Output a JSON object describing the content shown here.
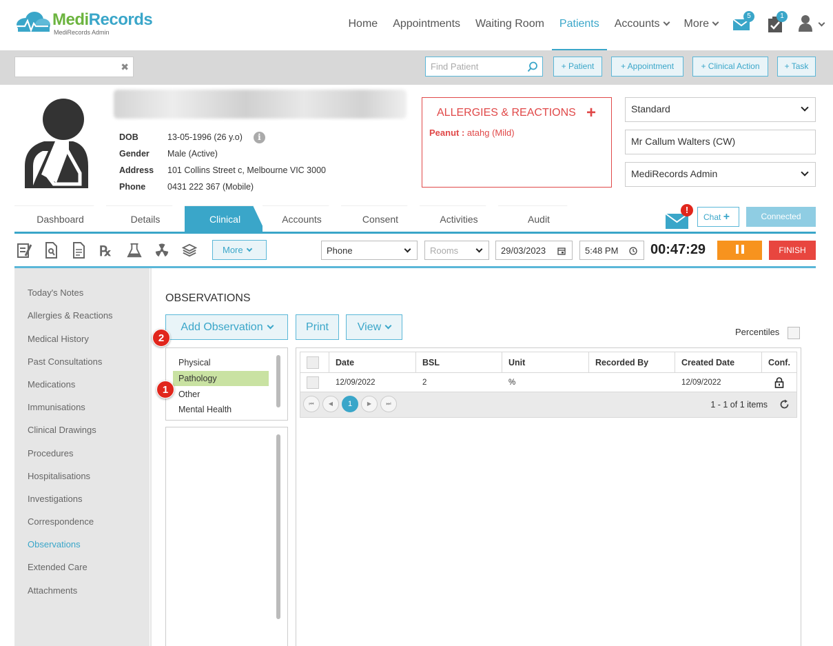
{
  "brand": {
    "name_part1": "Medi",
    "name_part2": "Records",
    "subtitle": "MediRecords Admin"
  },
  "nav": {
    "items": [
      {
        "label": "Home"
      },
      {
        "label": "Appointments"
      },
      {
        "label": "Waiting Room"
      },
      {
        "label": "Patients"
      },
      {
        "label": "Accounts"
      },
      {
        "label": "More"
      }
    ],
    "active": "Patients",
    "mail_badge": "5",
    "tasks_badge": "1"
  },
  "toolbar": {
    "find_placeholder": "Find Patient",
    "buttons": [
      "+ Patient",
      "+ Appointment",
      "+ Clinical Action",
      "+ Task"
    ]
  },
  "patient": {
    "fields": [
      {
        "label": "DOB",
        "value": "13-05-1996 (26 y.o)"
      },
      {
        "label": "Gender",
        "value": "Male (Active)"
      },
      {
        "label": "Address",
        "value": "101 Collins Street c, Melbourne VIC 3000"
      },
      {
        "label": "Phone",
        "value": "0431 222 367 (Mobile)"
      }
    ],
    "info_glyph": "i"
  },
  "allergies": {
    "title": "ALLERGIES & REACTIONS",
    "plus": "+",
    "item_name": "Peanut :",
    "item_detail": "atahg (Mild)"
  },
  "selectors": {
    "billing": "Standard",
    "practitioner": "Mr Callum Walters (CW)",
    "location": "MediRecords Admin"
  },
  "tabs": {
    "items": [
      "Dashboard",
      "Details",
      "Clinical",
      "Accounts",
      "Consent",
      "Activities",
      "Audit"
    ],
    "active": "Clinical"
  },
  "comms": {
    "alert_mark": "!",
    "chat_label": "Chat",
    "chat_plus": "+",
    "connected_label": "Connected"
  },
  "clinical_toolbar": {
    "more_label": "More",
    "consult_type": "Phone",
    "rooms_placeholder": "Rooms",
    "date": "29/03/2023",
    "time": "5:48 PM",
    "timer": "00:47:29",
    "finish_label": "FINISH"
  },
  "sidebar": {
    "items": [
      "Today's Notes",
      "Allergies & Reactions",
      "Medical History",
      "Past Consultations",
      "Medications",
      "Immunisations",
      "Clinical Drawings",
      "Procedures",
      "Hospitalisations",
      "Investigations",
      "Correspondence",
      "Observations",
      "Extended Care",
      "Attachments"
    ],
    "active": "Observations"
  },
  "observations": {
    "title": "OBSERVATIONS",
    "add_label": "Add Observation",
    "print_label": "Print",
    "view_label": "View",
    "percentiles_label": "Percentiles",
    "categories": [
      "Physical",
      "Pathology",
      "Other",
      "Mental Health"
    ],
    "selected_category": "Pathology",
    "markers": [
      "1",
      "2"
    ],
    "columns": [
      "Date",
      "BSL",
      "Unit",
      "Recorded By",
      "Created Date",
      "Conf."
    ],
    "rows": [
      {
        "date": "12/09/2022",
        "bsl": "2",
        "unit": "%",
        "recorded_by": "",
        "created": "12/09/2022"
      }
    ],
    "pager": {
      "current_page": "1",
      "summary": "1 - 1 of 1 items"
    }
  }
}
